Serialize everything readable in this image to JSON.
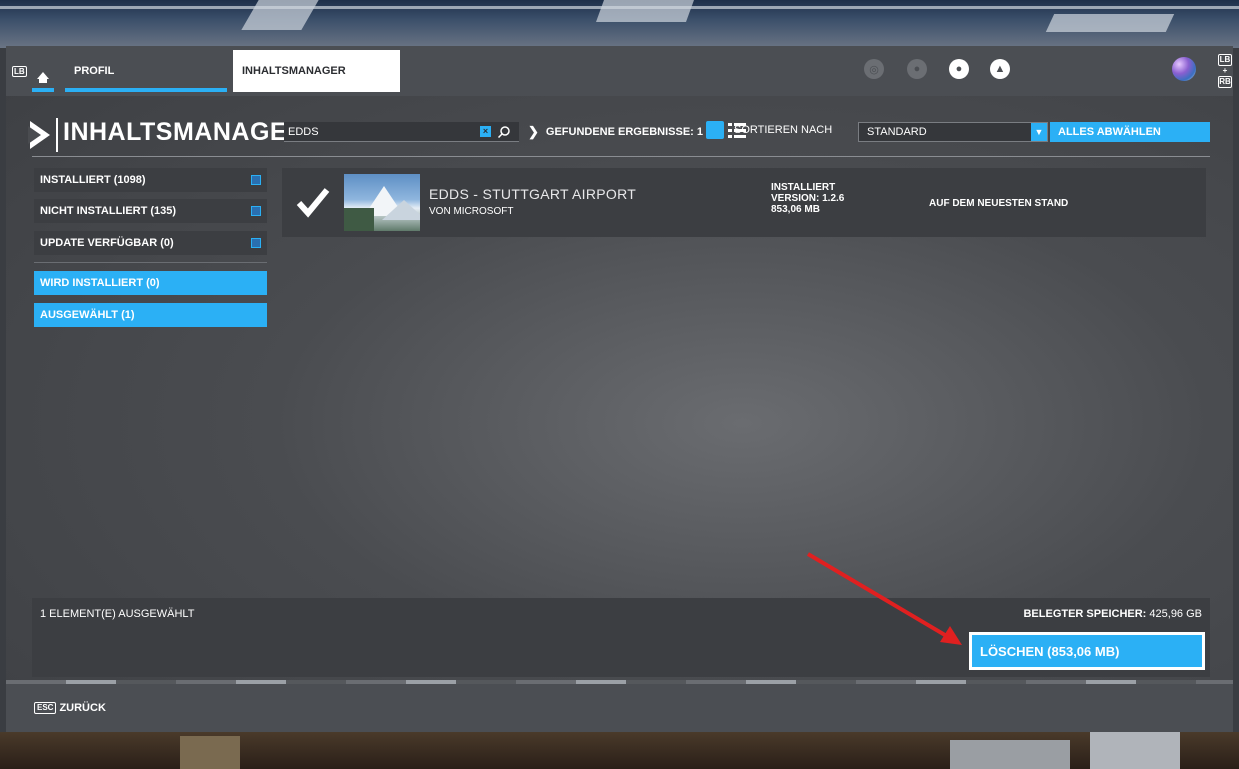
{
  "nav": {
    "lb_label": "LB",
    "tabs": [
      {
        "label": "PROFIL"
      },
      {
        "label": "INHALTSMANAGER"
      }
    ],
    "icons": [
      "stats-icon",
      "friends-icon",
      "profile-icon",
      "notifications-icon"
    ],
    "rb_stack": [
      "LB",
      "+",
      "RB"
    ]
  },
  "header": {
    "title": "INHALTSMANAGER",
    "search": {
      "value": "EDDS",
      "placeholder": ""
    },
    "results_label": "GEFUNDENE ERGEBNISSE: 1",
    "sort_label": "SORTIEREN NACH",
    "sort_value": "STANDARD",
    "deselect_label": "ALLES ABWÄHLEN"
  },
  "sidebar": {
    "filters": [
      {
        "label": "INSTALLIERT (1098)",
        "checked": true
      },
      {
        "label": "NICHT INSTALLIERT (135)",
        "checked": true
      },
      {
        "label": "UPDATE VERFÜGBAR (0)",
        "checked": true
      }
    ],
    "status": [
      {
        "label": "WIRD INSTALLIERT (0)"
      },
      {
        "label": "AUSGEWÄHLT (1)"
      }
    ]
  },
  "item": {
    "title": "EDDS - STUTTGART AIRPORT",
    "author": "VON MICROSOFT",
    "status": "INSTALLIERT",
    "version": "VERSION: 1.2.6",
    "size": "853,06 MB",
    "uptodate": "AUF DEM NEUESTEN STAND"
  },
  "bottom": {
    "selected_count": "1 ELEMENT(E) AUSGEWÄHLT",
    "storage_label": "BELEGTER SPEICHER:",
    "storage_value": "425,96 GB",
    "delete_label": "LÖSCHEN (853,06 MB)"
  },
  "footer": {
    "esc_label": "ESC",
    "back_label": "ZURÜCK"
  },
  "colors": {
    "accent": "#2bb0f5",
    "annotation": "#e02020"
  }
}
